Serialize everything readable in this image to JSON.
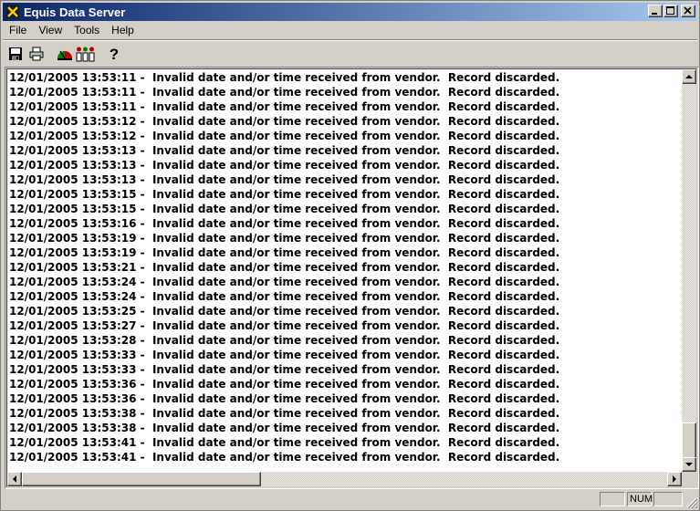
{
  "window": {
    "title": "Equis Data Server"
  },
  "menu": {
    "items": [
      "File",
      "View",
      "Tools",
      "Help"
    ]
  },
  "toolbar": {
    "buttons": [
      "save-icon",
      "print-icon",
      "gauge-icon",
      "signal-bars-icon",
      "help-icon"
    ],
    "help_glyph": "?"
  },
  "log": {
    "message": "Invalid date and/or time received from vendor.  Record discarded.",
    "date": "12/01/2005",
    "times": [
      "13:53:11",
      "13:53:11",
      "13:53:11",
      "13:53:12",
      "13:53:12",
      "13:53:13",
      "13:53:13",
      "13:53:13",
      "13:53:15",
      "13:53:15",
      "13:53:16",
      "13:53:19",
      "13:53:19",
      "13:53:21",
      "13:53:24",
      "13:53:24",
      "13:53:25",
      "13:53:27",
      "13:53:28",
      "13:53:33",
      "13:53:33",
      "13:53:36",
      "13:53:36",
      "13:53:38",
      "13:53:38",
      "13:53:41",
      "13:53:41"
    ]
  },
  "statusbar": {
    "panes": [
      "",
      "NUM",
      ""
    ]
  }
}
